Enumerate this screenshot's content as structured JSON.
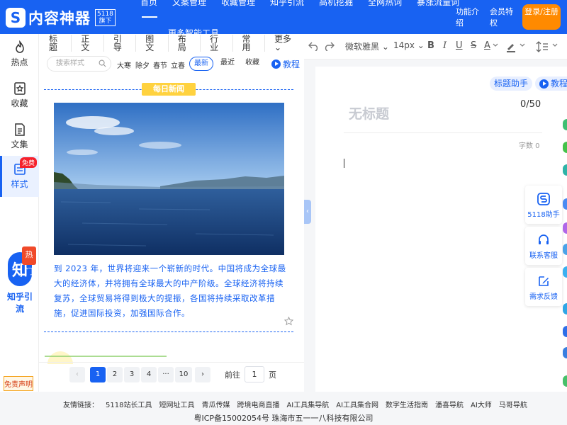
{
  "header": {
    "logo_mark": "S",
    "logo_text": "内容神器",
    "logo_badge_line1": "5118",
    "logo_badge_line2": "旗下",
    "nav": [
      "首页",
      "文案管理",
      "收藏管理",
      "知乎引流",
      "高机挖掘",
      "全网热词",
      "暴涨流量词"
    ],
    "nav_more": "更多智能工具 ⌄",
    "feature_intro": "功能介绍",
    "member_perks": "会员特权",
    "login": "登录/注册"
  },
  "sidebar": {
    "items": [
      {
        "label": "热点",
        "icon": "flame-icon"
      },
      {
        "label": "收藏",
        "icon": "star-bookmark-icon"
      },
      {
        "label": "文集",
        "icon": "document-icon"
      },
      {
        "label": "样式",
        "icon": "style-list-icon"
      }
    ],
    "free_badge": "免费",
    "zhihu_logo": "知",
    "zhihu_hot": "热门",
    "zhihu_label": "知乎引流",
    "disclaimer": "免责声明"
  },
  "panel": {
    "categories": [
      "标题",
      "正文",
      "引导",
      "图文",
      "布局",
      "行业",
      "常用",
      "更多 ⌄"
    ],
    "search_placeholder": "搜索样式",
    "tags": [
      "大寒",
      "除夕",
      "春节",
      "立春"
    ],
    "sort": [
      "最新",
      "最近",
      "收藏"
    ],
    "tutorial": "教程",
    "news_title": "每日新闻",
    "news_text": "到 2023 年，世界将迎来一个崭新的时代。中国将成为全球最大的经济体，并将拥有全球最大的中产阶级。全球经济将持续复苏，全球贸易将得到极大的提振，各国将持续采取改革措施，促进国际投资，加强国际合作。"
  },
  "pager": {
    "pages": [
      "1",
      "2",
      "3",
      "4",
      "···",
      "10"
    ],
    "prev": "‹",
    "next": "›",
    "goto_label": "前往",
    "goto_value": "1",
    "page_unit": "页"
  },
  "toolbar": {
    "font_family": "微软雅黑 ⌄",
    "font_size": "14px ⌄",
    "bold": "B",
    "italic": "I",
    "underline": "U",
    "strike": "S",
    "font_color": "A"
  },
  "editor": {
    "title_helper": "标题助手",
    "tutorial": "教程",
    "title_placeholder": "无标题",
    "title_count": "0/50",
    "word_count": "字数 0"
  },
  "float_tools": [
    {
      "label": "5118助手",
      "icon": "assistant-s-icon"
    },
    {
      "label": "联系客服",
      "icon": "headset-icon"
    },
    {
      "label": "需求反馈",
      "icon": "feedback-edit-icon"
    }
  ],
  "footer": {
    "links": [
      "友情链接：",
      "5118站长工具",
      "短网址工具",
      "青瓜传媒",
      "跨境电商直播",
      "AI工具集导航",
      "AI工具集合网",
      "数字生活指南",
      "潘喜导航",
      "AI大师",
      "马哥导航"
    ],
    "icp": "粤ICP备15002054号 珠海市五一一八科技有限公司"
  },
  "colors": {
    "brand": "#1862f2",
    "login": "#ff8a00",
    "news_tag": "#ffd23f",
    "hot": "#f04a2a"
  }
}
